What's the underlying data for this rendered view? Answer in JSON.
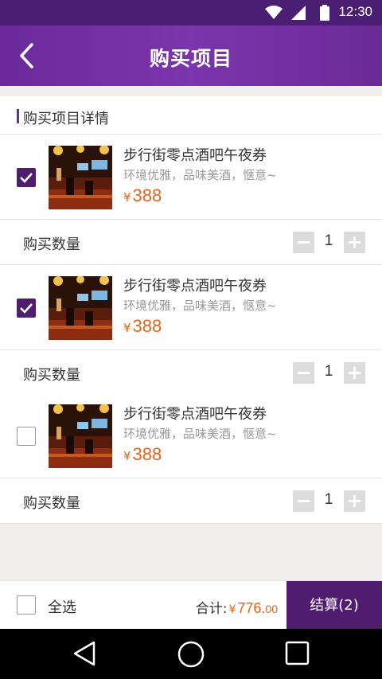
{
  "status": {
    "time": "12:30"
  },
  "header": {
    "title": "购买项目"
  },
  "section": {
    "title": "购买项目详情"
  },
  "items": [
    {
      "name": "步行街零点酒吧午夜券",
      "desc": "环境优雅，品味美酒，惬意~",
      "currency": "¥",
      "price": "388",
      "checked": true,
      "qty_label": "购买数量",
      "qty": "1"
    },
    {
      "name": "步行街零点酒吧午夜券",
      "desc": "环境优雅，品味美酒，惬意~",
      "currency": "¥",
      "price": "388",
      "checked": true,
      "qty_label": "购买数量",
      "qty": "1"
    },
    {
      "name": "步行街零点酒吧午夜券",
      "desc": "环境优雅，品味美酒，惬意~",
      "currency": "¥",
      "price": "388",
      "checked": false,
      "qty_label": "购买数量",
      "qty": "1"
    }
  ],
  "footer": {
    "select_all_label": "全选",
    "total_label": "合计:",
    "currency": "¥",
    "total_int": "776.",
    "total_dec": "00",
    "checkout_label": "结算(2)"
  },
  "colors": {
    "accent": "#4f1c6f",
    "header": "#6b2a9a",
    "price": "#e8631a"
  }
}
